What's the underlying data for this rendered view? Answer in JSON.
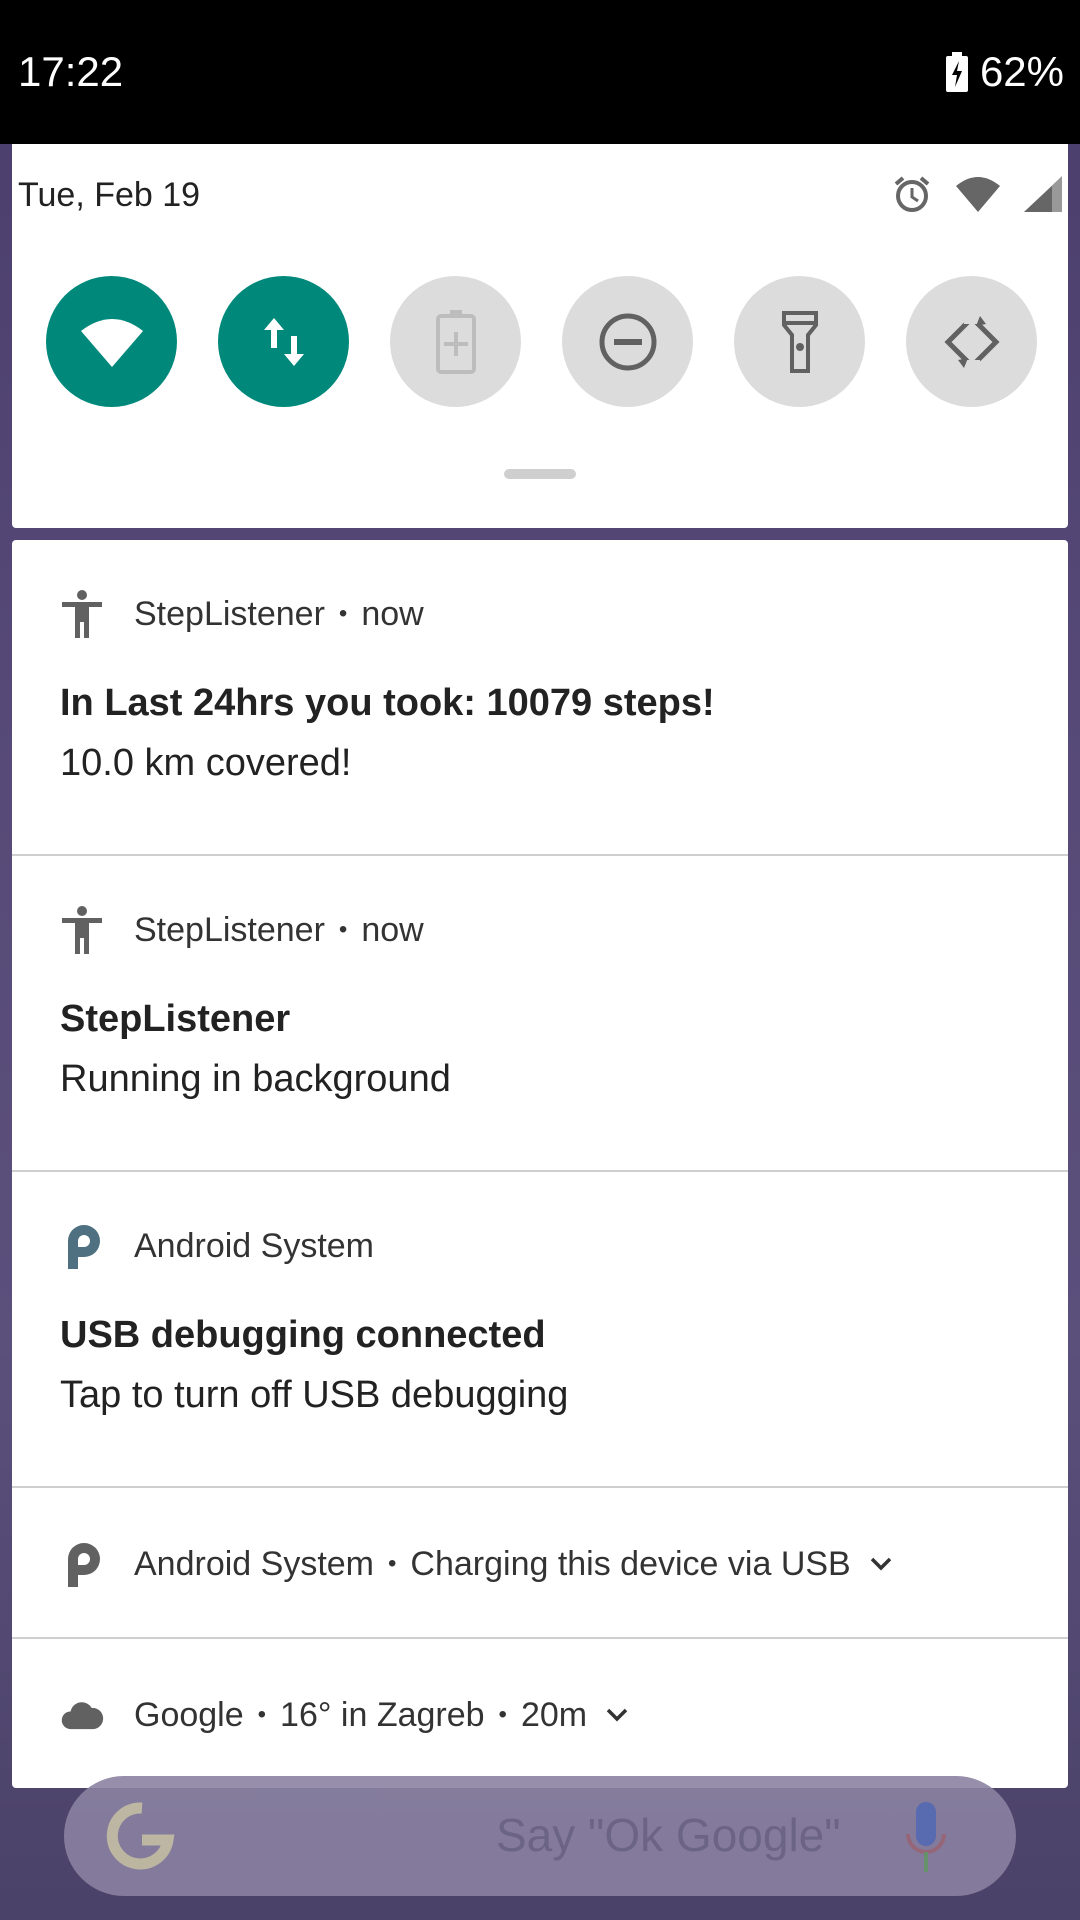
{
  "status_bar": {
    "time": "17:22",
    "battery_percent": "62%"
  },
  "quick_settings": {
    "date": "Tue, Feb 19",
    "status_icons": [
      "alarm-icon",
      "wifi-icon",
      "cell-signal-icon"
    ],
    "tiles": [
      {
        "name": "wifi",
        "state": "on"
      },
      {
        "name": "mobile-data",
        "state": "on"
      },
      {
        "name": "battery-saver",
        "state": "off"
      },
      {
        "name": "do-not-disturb",
        "state": "off"
      },
      {
        "name": "flashlight",
        "state": "off"
      },
      {
        "name": "auto-rotate",
        "state": "off"
      }
    ]
  },
  "notifications": [
    {
      "app": "StepListener",
      "time": "now",
      "title": "In Last 24hrs you took: 10079 steps!",
      "text": "10.0 km covered!",
      "icon": "accessibility-icon"
    },
    {
      "app": "StepListener",
      "time": "now",
      "title": "StepListener",
      "text": "Running in background",
      "icon": "accessibility-icon"
    },
    {
      "app": "Android System",
      "title": "USB debugging connected",
      "text": "Tap to turn off USB debugging",
      "icon": "android-p-icon"
    },
    {
      "app": "Android System",
      "summary": "Charging this device via USB",
      "icon": "android-p-icon"
    },
    {
      "app": "Google",
      "summary": "16° in Zagreb",
      "time": "20m",
      "icon": "cloud-icon"
    }
  ],
  "search": {
    "hint": "Say \"Ok Google\""
  },
  "colors": {
    "accent": "#00897b",
    "tile_off": "#dcdcdc",
    "status_bar": "#000000"
  }
}
